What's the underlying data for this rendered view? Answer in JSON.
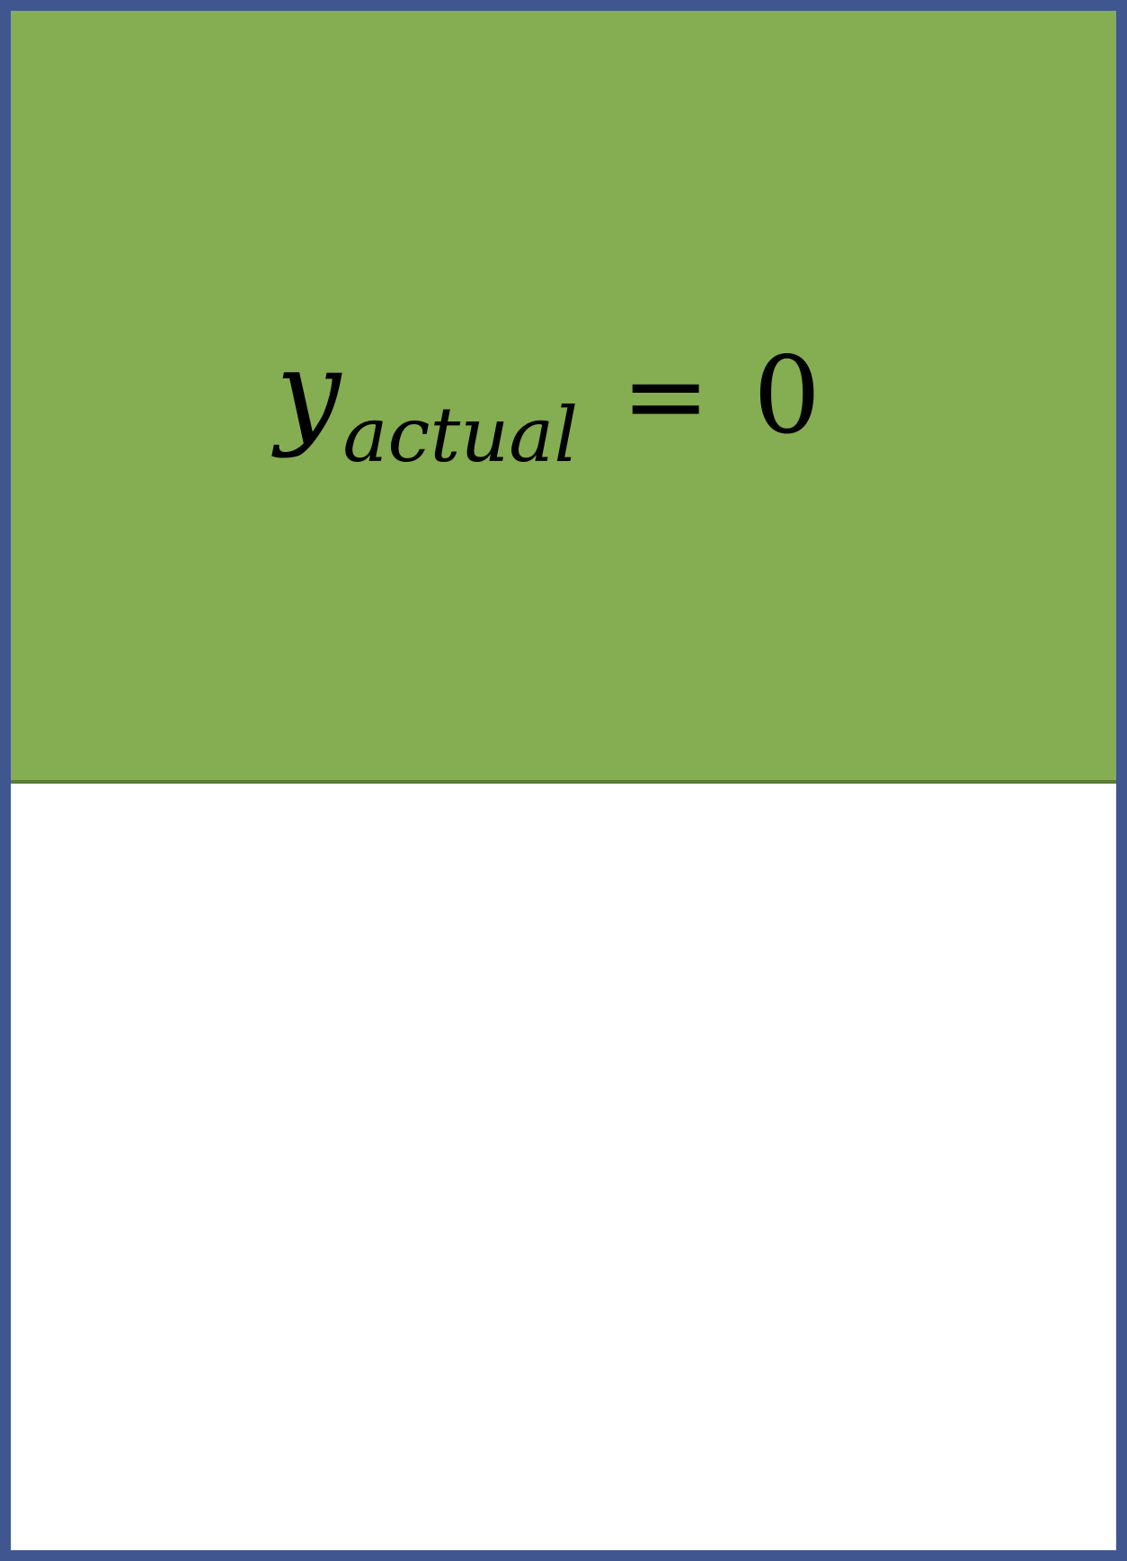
{
  "equation": {
    "variable": "y",
    "subscript": "actual",
    "operator": "=",
    "value": "0"
  },
  "colors": {
    "border": "#3f5690",
    "top_panel_fill": "#85ad52",
    "top_panel_edge": "#5b7b38",
    "bottom_panel_fill": "#ffffff"
  }
}
